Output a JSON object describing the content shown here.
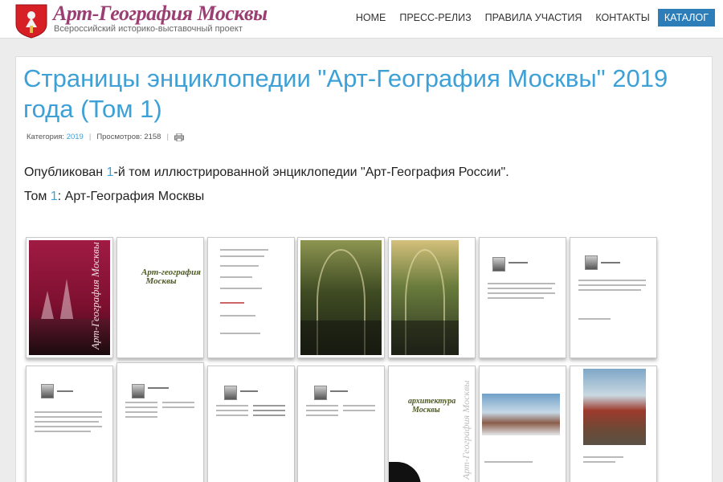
{
  "site": {
    "title": "Арт-География Москвы",
    "subtitle": "Всероссийский историко-выставочный проект"
  },
  "nav": {
    "items": [
      "HOME",
      "ПРЕСС-РЕЛИЗ",
      "ПРАВИЛА УЧАСТИЯ",
      "КОНТАКТЫ"
    ],
    "catalog": "КАТАЛОГ"
  },
  "article": {
    "title": "Страницы энциклопедии \"Арт-География Москвы\" 2019 года (Том 1)",
    "category_label": "Категория:",
    "category_value": "2019",
    "views_label": "Просмотров:",
    "views_value": "2158",
    "lead_before": "Опубликован ",
    "lead_num": "1",
    "lead_after": "-й том иллюстрированной энциклопедии \"Арт-География России\".",
    "volume_before": "Том ",
    "volume_num": "1",
    "volume_after": ": Арт-География Москвы"
  },
  "thumbnails": {
    "cover_title": "Арт-География Москвы",
    "logo_line1": "Арт-география",
    "logo_line2": "Москвы",
    "section_line1": "архитектура",
    "section_line2": "Москвы",
    "spine": "Арт-География Москвы"
  },
  "colors": {
    "accent": "#3da0d6",
    "catalog_bg": "#2c7db8",
    "brand": "#9b3f73"
  }
}
